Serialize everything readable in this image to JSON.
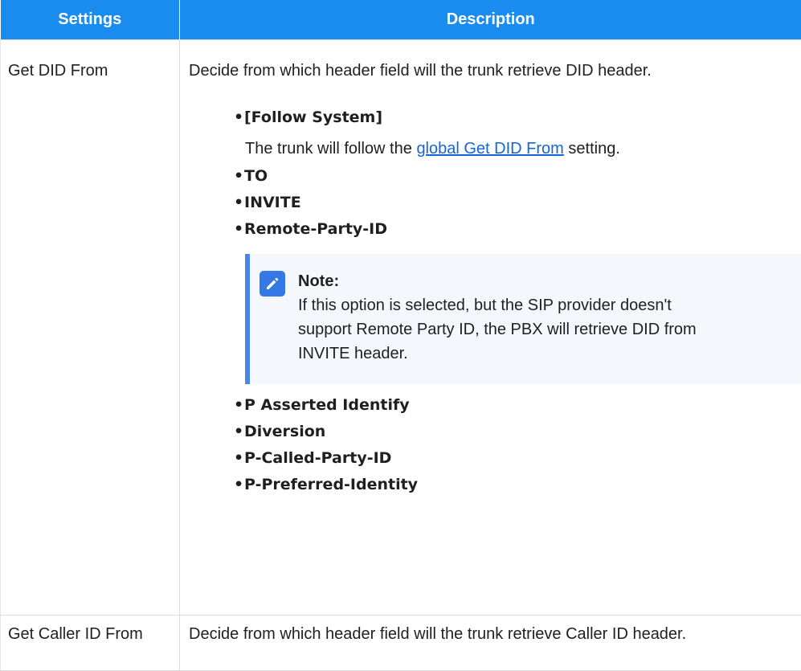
{
  "header": {
    "settings_label": "Settings",
    "description_label": "Description"
  },
  "rows": [
    {
      "setting": "Get DID From",
      "description": "Decide from which header field will the trunk retrieve DID header.",
      "options": [
        "[Follow System]",
        "TO",
        "INVITE",
        "Remote-Party-ID",
        "P Asserted Identify",
        "Diversion",
        "P-Called-Party-ID",
        "P-Preferred-Identity"
      ],
      "follow_system_text_before": "The trunk will follow the",
      "follow_system_link": "global Get DID From",
      "follow_system_text_after": "setting.",
      "note": {
        "icon": "edit-note-icon",
        "title": "Note:",
        "text": "If this option is selected, but the SIP provider doesn't support Remote Party ID, the PBX will retrieve DID from INVITE header."
      }
    },
    {
      "setting": "Get Caller ID From",
      "description": "Decide from which header field will the trunk retrieve Caller ID header."
    }
  ],
  "colors": {
    "header_bg": "#1a8cf0",
    "link": "#1565d8",
    "note_border": "#4a86e8",
    "note_bg": "#f4f7fb"
  }
}
